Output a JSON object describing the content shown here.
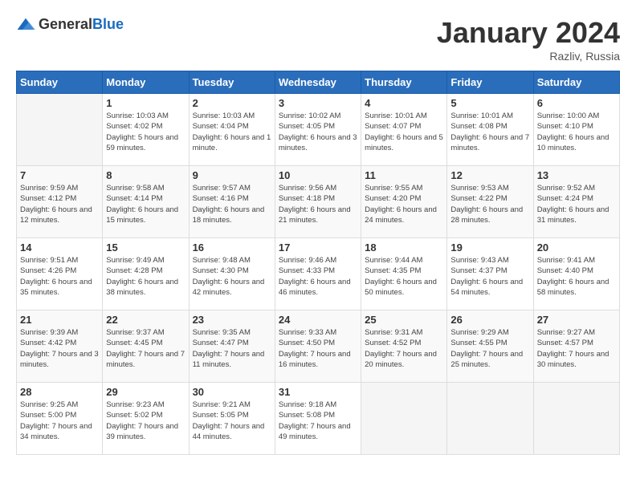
{
  "logo": {
    "general": "General",
    "blue": "Blue"
  },
  "header": {
    "month": "January 2024",
    "location": "Razliv, Russia"
  },
  "weekdays": [
    "Sunday",
    "Monday",
    "Tuesday",
    "Wednesday",
    "Thursday",
    "Friday",
    "Saturday"
  ],
  "weeks": [
    [
      {
        "day": "",
        "empty": true
      },
      {
        "day": "1",
        "sunrise": "Sunrise: 10:03 AM",
        "sunset": "Sunset: 4:02 PM",
        "daylight": "Daylight: 5 hours and 59 minutes."
      },
      {
        "day": "2",
        "sunrise": "Sunrise: 10:03 AM",
        "sunset": "Sunset: 4:04 PM",
        "daylight": "Daylight: 6 hours and 1 minute."
      },
      {
        "day": "3",
        "sunrise": "Sunrise: 10:02 AM",
        "sunset": "Sunset: 4:05 PM",
        "daylight": "Daylight: 6 hours and 3 minutes."
      },
      {
        "day": "4",
        "sunrise": "Sunrise: 10:01 AM",
        "sunset": "Sunset: 4:07 PM",
        "daylight": "Daylight: 6 hours and 5 minutes."
      },
      {
        "day": "5",
        "sunrise": "Sunrise: 10:01 AM",
        "sunset": "Sunset: 4:08 PM",
        "daylight": "Daylight: 6 hours and 7 minutes."
      },
      {
        "day": "6",
        "sunrise": "Sunrise: 10:00 AM",
        "sunset": "Sunset: 4:10 PM",
        "daylight": "Daylight: 6 hours and 10 minutes."
      }
    ],
    [
      {
        "day": "7",
        "sunrise": "Sunrise: 9:59 AM",
        "sunset": "Sunset: 4:12 PM",
        "daylight": "Daylight: 6 hours and 12 minutes."
      },
      {
        "day": "8",
        "sunrise": "Sunrise: 9:58 AM",
        "sunset": "Sunset: 4:14 PM",
        "daylight": "Daylight: 6 hours and 15 minutes."
      },
      {
        "day": "9",
        "sunrise": "Sunrise: 9:57 AM",
        "sunset": "Sunset: 4:16 PM",
        "daylight": "Daylight: 6 hours and 18 minutes."
      },
      {
        "day": "10",
        "sunrise": "Sunrise: 9:56 AM",
        "sunset": "Sunset: 4:18 PM",
        "daylight": "Daylight: 6 hours and 21 minutes."
      },
      {
        "day": "11",
        "sunrise": "Sunrise: 9:55 AM",
        "sunset": "Sunset: 4:20 PM",
        "daylight": "Daylight: 6 hours and 24 minutes."
      },
      {
        "day": "12",
        "sunrise": "Sunrise: 9:53 AM",
        "sunset": "Sunset: 4:22 PM",
        "daylight": "Daylight: 6 hours and 28 minutes."
      },
      {
        "day": "13",
        "sunrise": "Sunrise: 9:52 AM",
        "sunset": "Sunset: 4:24 PM",
        "daylight": "Daylight: 6 hours and 31 minutes."
      }
    ],
    [
      {
        "day": "14",
        "sunrise": "Sunrise: 9:51 AM",
        "sunset": "Sunset: 4:26 PM",
        "daylight": "Daylight: 6 hours and 35 minutes."
      },
      {
        "day": "15",
        "sunrise": "Sunrise: 9:49 AM",
        "sunset": "Sunset: 4:28 PM",
        "daylight": "Daylight: 6 hours and 38 minutes."
      },
      {
        "day": "16",
        "sunrise": "Sunrise: 9:48 AM",
        "sunset": "Sunset: 4:30 PM",
        "daylight": "Daylight: 6 hours and 42 minutes."
      },
      {
        "day": "17",
        "sunrise": "Sunrise: 9:46 AM",
        "sunset": "Sunset: 4:33 PM",
        "daylight": "Daylight: 6 hours and 46 minutes."
      },
      {
        "day": "18",
        "sunrise": "Sunrise: 9:44 AM",
        "sunset": "Sunset: 4:35 PM",
        "daylight": "Daylight: 6 hours and 50 minutes."
      },
      {
        "day": "19",
        "sunrise": "Sunrise: 9:43 AM",
        "sunset": "Sunset: 4:37 PM",
        "daylight": "Daylight: 6 hours and 54 minutes."
      },
      {
        "day": "20",
        "sunrise": "Sunrise: 9:41 AM",
        "sunset": "Sunset: 4:40 PM",
        "daylight": "Daylight: 6 hours and 58 minutes."
      }
    ],
    [
      {
        "day": "21",
        "sunrise": "Sunrise: 9:39 AM",
        "sunset": "Sunset: 4:42 PM",
        "daylight": "Daylight: 7 hours and 3 minutes."
      },
      {
        "day": "22",
        "sunrise": "Sunrise: 9:37 AM",
        "sunset": "Sunset: 4:45 PM",
        "daylight": "Daylight: 7 hours and 7 minutes."
      },
      {
        "day": "23",
        "sunrise": "Sunrise: 9:35 AM",
        "sunset": "Sunset: 4:47 PM",
        "daylight": "Daylight: 7 hours and 11 minutes."
      },
      {
        "day": "24",
        "sunrise": "Sunrise: 9:33 AM",
        "sunset": "Sunset: 4:50 PM",
        "daylight": "Daylight: 7 hours and 16 minutes."
      },
      {
        "day": "25",
        "sunrise": "Sunrise: 9:31 AM",
        "sunset": "Sunset: 4:52 PM",
        "daylight": "Daylight: 7 hours and 20 minutes."
      },
      {
        "day": "26",
        "sunrise": "Sunrise: 9:29 AM",
        "sunset": "Sunset: 4:55 PM",
        "daylight": "Daylight: 7 hours and 25 minutes."
      },
      {
        "day": "27",
        "sunrise": "Sunrise: 9:27 AM",
        "sunset": "Sunset: 4:57 PM",
        "daylight": "Daylight: 7 hours and 30 minutes."
      }
    ],
    [
      {
        "day": "28",
        "sunrise": "Sunrise: 9:25 AM",
        "sunset": "Sunset: 5:00 PM",
        "daylight": "Daylight: 7 hours and 34 minutes."
      },
      {
        "day": "29",
        "sunrise": "Sunrise: 9:23 AM",
        "sunset": "Sunset: 5:02 PM",
        "daylight": "Daylight: 7 hours and 39 minutes."
      },
      {
        "day": "30",
        "sunrise": "Sunrise: 9:21 AM",
        "sunset": "Sunset: 5:05 PM",
        "daylight": "Daylight: 7 hours and 44 minutes."
      },
      {
        "day": "31",
        "sunrise": "Sunrise: 9:18 AM",
        "sunset": "Sunset: 5:08 PM",
        "daylight": "Daylight: 7 hours and 49 minutes."
      },
      {
        "day": "",
        "empty": true
      },
      {
        "day": "",
        "empty": true
      },
      {
        "day": "",
        "empty": true
      }
    ]
  ]
}
